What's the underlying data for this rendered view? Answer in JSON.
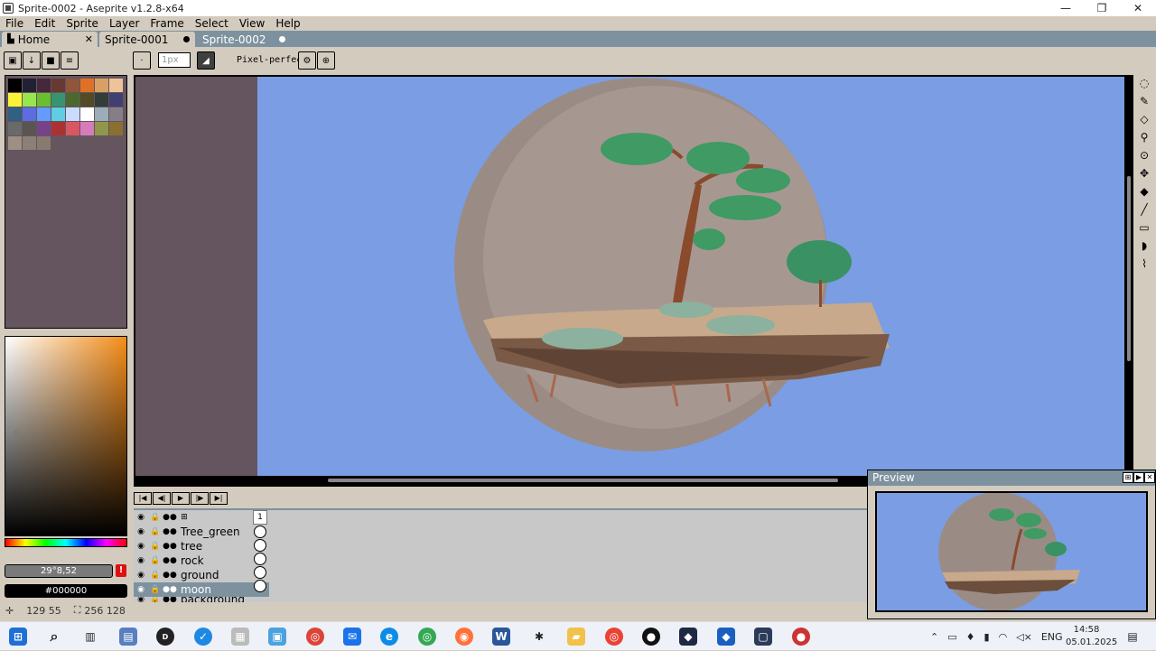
{
  "window": {
    "title": "Sprite-0002 - Aseprite v1.2.8-x64",
    "min": "—",
    "restore": "❐",
    "close": "✕"
  },
  "menu": [
    "File",
    "Edit",
    "Sprite",
    "Layer",
    "Frame",
    "Select",
    "View",
    "Help"
  ],
  "tabs": [
    {
      "label": "Home",
      "close": "✕"
    },
    {
      "label": "Sprite-0001"
    },
    {
      "label": "Sprite-0002"
    }
  ],
  "context_bar": {
    "brush_size_placeholder": "1px",
    "pixel_perfect_label": "Pixel-perfect"
  },
  "palette": [
    "#000000",
    "#222034",
    "#45283c",
    "#663931",
    "#8f563b",
    "#df7126",
    "#d9a066",
    "#eec39a",
    "#fbf236",
    "#99e550",
    "#6abe30",
    "#37946e",
    "#4b692f",
    "#524b24",
    "#323c39",
    "#3f3f74",
    "#306082",
    "#5b6ee1",
    "#639bff",
    "#5fcde4",
    "#cbdbfc",
    "#ffffff",
    "#9badb7",
    "#847e87",
    "#696a6a",
    "#595652",
    "#76428a",
    "#ac3232",
    "#d95763",
    "#d77bba",
    "#8f974a",
    "#8a6f30",
    "#9e8f84",
    "#8c7f76",
    "#877a70"
  ],
  "color": {
    "hsv_text": "29°8,52",
    "hex_text": "#000000",
    "warning": "!"
  },
  "timeline": {
    "frame_number": "1",
    "layers": [
      {
        "name": "Tree_green"
      },
      {
        "name": "tree"
      },
      {
        "name": "rock"
      },
      {
        "name": "ground"
      },
      {
        "name": "moon",
        "selected": true
      },
      {
        "name": "background"
      }
    ]
  },
  "preview": {
    "title": "Preview"
  },
  "status": {
    "cursor_pos": "129 55",
    "sprite_size": "256 128"
  },
  "tray": {
    "lang": "ENG",
    "time": "14:58",
    "date": "05.01.2025"
  }
}
